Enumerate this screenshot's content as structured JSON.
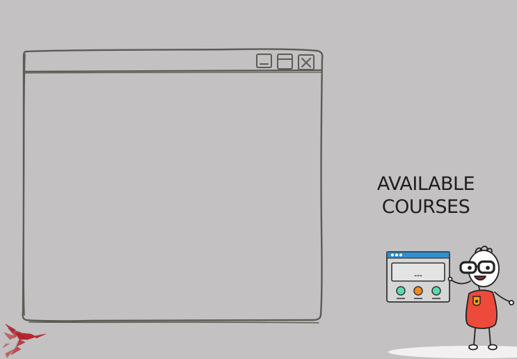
{
  "heading": {
    "line1": "AVAILABLE",
    "line2": "COURSES"
  },
  "window": {
    "controls": [
      "minimize-icon",
      "maximize-icon",
      "close-icon"
    ]
  },
  "mascot": {
    "screen_text": "---"
  },
  "colors": {
    "background": "#c3c1c2",
    "sketch_stroke": "#5b5c55",
    "accent_blue": "#2f8fd0",
    "accent_red": "#ee4a3b",
    "accent_orange": "#f08a24",
    "accent_teal": "#5cd8b0",
    "logo_red": "#b8262d"
  }
}
